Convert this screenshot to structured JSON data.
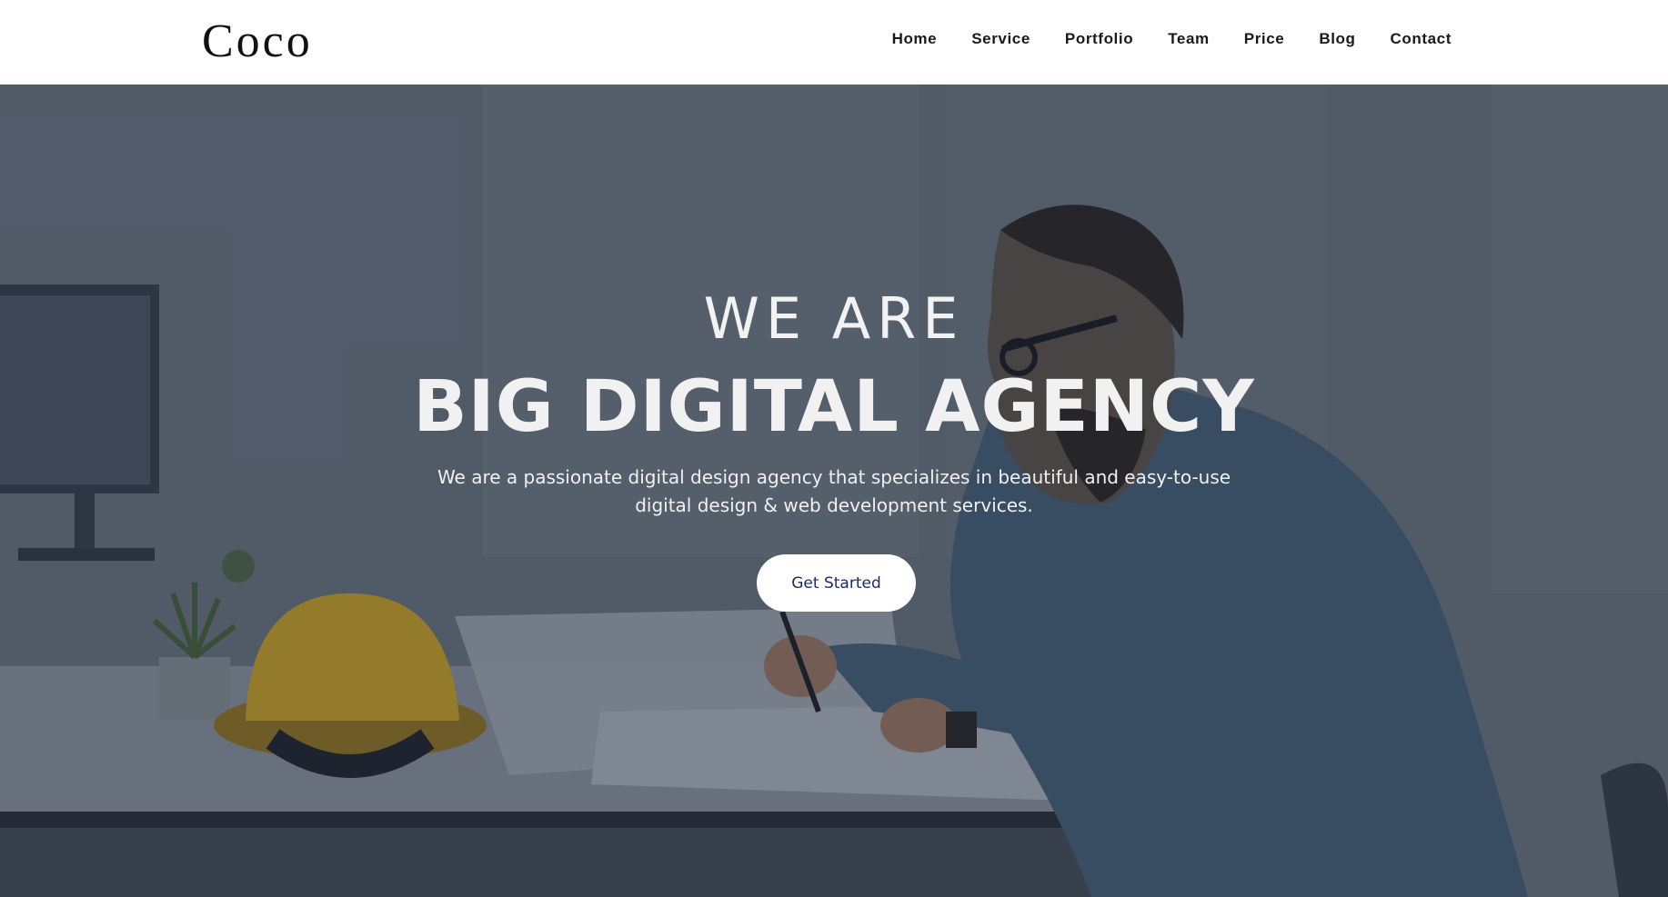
{
  "header": {
    "logo": "Coco",
    "nav": [
      {
        "label": "Home"
      },
      {
        "label": "Service"
      },
      {
        "label": "Portfolio"
      },
      {
        "label": "Team"
      },
      {
        "label": "Price"
      },
      {
        "label": "Blog"
      },
      {
        "label": "Contact"
      }
    ]
  },
  "hero": {
    "eyebrow": "WE ARE",
    "title": "BIG DIGITAL AGENCY",
    "description": "We are a passionate digital design agency that specializes in beautiful and easy-to-use digital design & web development services.",
    "cta_label": "Get Started",
    "colors": {
      "overlay": "#1c2638",
      "cta_text": "#1d2a6b",
      "helmet": "#e8b824",
      "shirt": "#4f6a82"
    }
  }
}
